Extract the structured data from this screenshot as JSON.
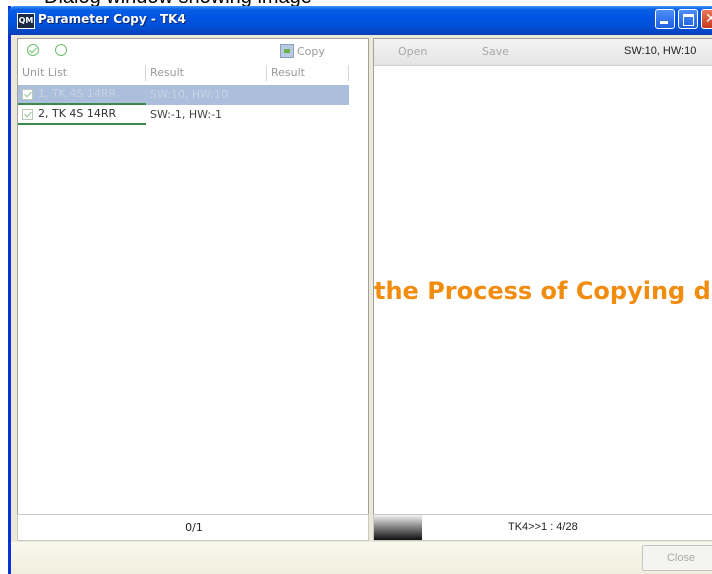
{
  "background_text": "Dialog window showing image",
  "window": {
    "icon_label": "QM",
    "title": "Parameter Copy - TK4"
  },
  "left_panel": {
    "copy_label": "Copy",
    "columns": [
      "Unit List",
      "Result",
      "Result"
    ],
    "rows": [
      {
        "unit": "1, TK 4S 14RR",
        "result1": "SW:10, HW:10",
        "result2": "",
        "selected": true
      },
      {
        "unit": "2, TK 4S 14RR",
        "result1": "SW:-1, HW:-1",
        "result2": "",
        "selected": false
      }
    ],
    "status": "0/1"
  },
  "right_panel": {
    "open_label": "Open",
    "save_label": "Save",
    "version": "SW:10, HW:10",
    "process_text": "the Process of Copying data",
    "progress_text": "TK4>>1 : 4/28"
  },
  "bottom": {
    "close_label": "Close"
  },
  "colors": {
    "title_bar": "#0054e3",
    "selected_row": "#abbfdc",
    "process_text": "#f28c0f",
    "row_underline": "#3a8a4c"
  },
  "icons": [
    "app-icon",
    "minimize-icon",
    "maximize-icon",
    "close-icon",
    "check-icon",
    "radio-icon",
    "copy-icon"
  ]
}
